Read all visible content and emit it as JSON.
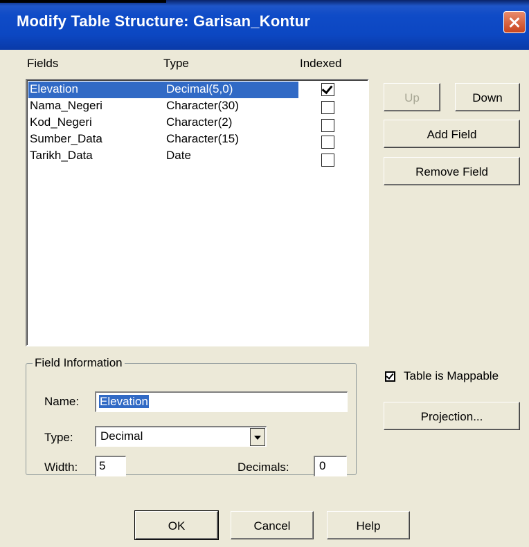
{
  "window": {
    "title": "Modify Table Structure: Garisan_Kontur"
  },
  "list": {
    "headers": {
      "fields": "Fields",
      "type": "Type",
      "indexed": "Indexed"
    },
    "rows": [
      {
        "field": "Elevation",
        "type": "Decimal(5,0)",
        "indexed": true,
        "selected": true
      },
      {
        "field": "Nama_Negeri",
        "type": "Character(30)",
        "indexed": false
      },
      {
        "field": "Kod_Negeri",
        "type": "Character(2)",
        "indexed": false
      },
      {
        "field": "Sumber_Data",
        "type": "Character(15)",
        "indexed": false
      },
      {
        "field": "Tarikh_Data",
        "type": "Date",
        "indexed": false
      }
    ]
  },
  "buttons": {
    "up": "Up",
    "down": "Down",
    "add_field": "Add Field",
    "remove_field": "Remove Field",
    "projection": "Projection...",
    "ok": "OK",
    "cancel": "Cancel",
    "help": "Help"
  },
  "field_info": {
    "group_label": "Field Information",
    "name_label": "Name:",
    "name_value": "Elevation",
    "type_label": "Type:",
    "type_value": "Decimal",
    "width_label": "Width:",
    "width_value": "5",
    "decimals_label": "Decimals:",
    "decimals_value": "0"
  },
  "mappable": {
    "label": "Table is Mappable",
    "checked": true
  },
  "colors": {
    "selection": "#316AC5",
    "dialog_bg": "#ECE9D8",
    "titlebar": "#0C47C2"
  }
}
